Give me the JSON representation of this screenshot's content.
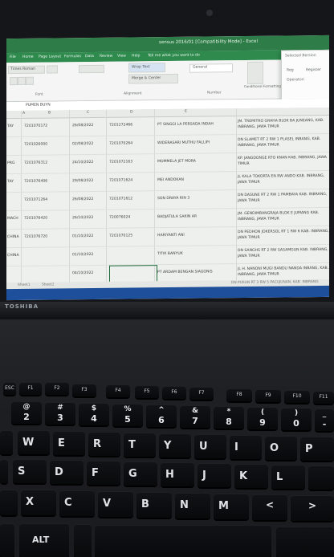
{
  "screen": {
    "window_title": "sensus 2016/01 [Compatibility Mode] - Excel",
    "menu": [
      "File",
      "Home",
      "Page Layout",
      "Formulas",
      "Data",
      "Review",
      "View",
      "Help",
      "Tell me what you want to do"
    ],
    "ribbon": {
      "font_name": "Times Roman",
      "wrap_text": "Wrap Text",
      "merge": "Merge & Center",
      "number_format": "General",
      "conditional": "Conditional Formatting",
      "captions": [
        "Font",
        "Alignment",
        "Number"
      ]
    },
    "side_panel": [
      "Selected Bersion",
      "Reg",
      "Register",
      "Operatori"
    ],
    "formula_bar": "PUMEN BUYN",
    "columns": [
      "A",
      "B",
      "C",
      "D",
      "E"
    ],
    "rows": [
      {
        "a": "TAY",
        "b": "7201070172",
        "c": "26/08/2022",
        "d": "7201272466",
        "name": "PT SINGGI LA PERSADA INDAH",
        "addr": "JM. TREMITRO GRAHA BLOK BA JUNEANG, KAB. INBRANG, JAWA TIMUR"
      },
      {
        "a": "",
        "b": "7201026000",
        "c": "02/08/2022",
        "d": "7201070264",
        "name": "WIDERASARI MUTHU FALLIPI",
        "addr": "DN SLAMET RT 2 RW 1 PLASEL INBANG, KAB. INBRANG, JAWA TIMUR"
      },
      {
        "a": "PRG",
        "b": "7201076312",
        "c": "24/10/2022",
        "d": "7201072163",
        "name": "MOMMELA JET MORA",
        "addr": "KP. JANGDONGE RTO KNAN KAB. INBRANG, JAWA TIMUR"
      },
      {
        "a": "TAY",
        "b": "7201076406",
        "c": "29/08/2022",
        "d": "7201071624",
        "name": "MEI ANDOKAN",
        "addr": "JL KALA TOKORTA EN RW ANDO KAB. INBRANG, JAWA TIMUR"
      },
      {
        "a": "",
        "b": "7201071264",
        "c": "26/08/2022",
        "d": "7201071612",
        "name": "SON DRAYA RIN 3",
        "addr": "DN DASUNE RT 2 RW 1 PAMBAYA KAB. INBRANG, JAWA TIMUR"
      },
      {
        "a": "MACH",
        "b": "7201076420",
        "c": "26/10/2022",
        "d": "720076024",
        "name": "BADJATULA SAKIN AR",
        "addr": "JM. GENDIMBANGRAJA BLOK E JUMANG KAB. INBRANG, JAWA TIMUR"
      },
      {
        "a": "CHINA",
        "b": "7201076720",
        "c": "01/10/2022",
        "d": "7201070125",
        "name": "HARIYANTI ANI",
        "addr": "DN PEDHON JOKERSOL RT 1 RW 6 KAB. INBRANG, JAWA TIMUR"
      },
      {
        "a": "CHINA",
        "b": "",
        "c": "01/10/2022",
        "d": "",
        "name": "TITIK BANYUK",
        "addr": "DN SANGHS RT 2 RW SASAMGUN KAB. INBRANG, JAWA TIMUR"
      },
      {
        "a": "",
        "b": "",
        "c": "04/10/2022",
        "d": "",
        "name": "PT ARDAM BENGAN SIAGONIS",
        "addr": "JL H. NANONI MUGI BANDU NANDA INBANG, KAB. INBRANG, JAWA TIMUR"
      }
    ],
    "sheet_tabs": [
      "Sheet1",
      "Sheet2"
    ],
    "last_row_hint": "DN PUSUN RT 3 RW 5 PACUJUNAN, KAB. INBRANG"
  },
  "laptop_brand": "TOSHIBA",
  "keyboard": {
    "fn_row": [
      "ESC",
      "F1",
      "F2",
      "F3",
      "F4",
      "F5",
      "F6",
      "F7",
      "F8",
      "F9",
      "F10",
      "F11"
    ],
    "number_row": [
      {
        "top": "@",
        "bottom": "2"
      },
      {
        "top": "#",
        "bottom": "3"
      },
      {
        "top": "$",
        "bottom": "4"
      },
      {
        "top": "%",
        "bottom": "5"
      },
      {
        "top": "^",
        "bottom": "6"
      },
      {
        "top": "&",
        "bottom": "7"
      },
      {
        "top": "*",
        "bottom": "8"
      },
      {
        "top": "(",
        "bottom": "9"
      },
      {
        "top": ")",
        "bottom": "0"
      },
      {
        "top": "_",
        "bottom": "-"
      }
    ],
    "row_qwerty": [
      "W",
      "E",
      "R",
      "T",
      "Y",
      "U",
      "I",
      "O",
      "P"
    ],
    "row_home": [
      "S",
      "D",
      "F",
      "G",
      "H",
      "J",
      "K",
      "L"
    ],
    "row_bottom": [
      "X",
      "C",
      "V",
      "B",
      "N",
      "M",
      "<",
      ">"
    ],
    "bottom_left": "ALT"
  }
}
